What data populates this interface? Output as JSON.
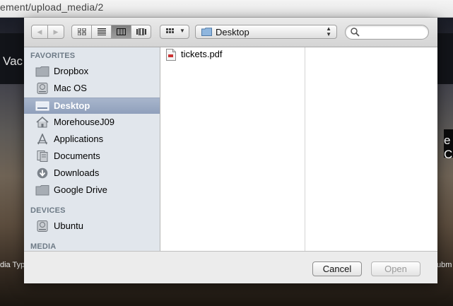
{
  "browser": {
    "url_text": "ement/upload_media/2"
  },
  "background_page": {
    "brand_text": "Vac",
    "edge_text_right": "e C",
    "media_type_label": "dia Type",
    "submit_fragment": "ubm"
  },
  "toolbar": {
    "back_icon": "back-arrow-icon",
    "forward_icon": "forward-arrow-icon",
    "views": [
      "icon-view",
      "list-view",
      "column-view",
      "cover-flow-view"
    ],
    "active_view": "column-view",
    "arrange_icon": "arrange-grid-icon",
    "location": "Desktop",
    "search": {
      "value": "",
      "placeholder": ""
    }
  },
  "sidebar": {
    "sections": [
      {
        "title": "FAVORITES",
        "items": [
          {
            "label": "Dropbox",
            "icon": "folder-icon"
          },
          {
            "label": "Mac OS",
            "icon": "hard-drive-icon"
          },
          {
            "label": "Desktop",
            "icon": "desktop-icon",
            "selected": true
          },
          {
            "label": "MorehouseJ09",
            "icon": "home-icon"
          },
          {
            "label": "Applications",
            "icon": "applications-icon"
          },
          {
            "label": "Documents",
            "icon": "documents-icon"
          },
          {
            "label": "Downloads",
            "icon": "downloads-icon"
          },
          {
            "label": "Google Drive",
            "icon": "folder-icon"
          }
        ]
      },
      {
        "title": "DEVICES",
        "items": [
          {
            "label": "Ubuntu",
            "icon": "hard-drive-icon"
          }
        ]
      },
      {
        "title": "MEDIA",
        "items": []
      }
    ]
  },
  "files": [
    {
      "name": "tickets.pdf",
      "icon": "pdf-file-icon"
    }
  ],
  "buttons": {
    "cancel": "Cancel",
    "open": "Open"
  }
}
